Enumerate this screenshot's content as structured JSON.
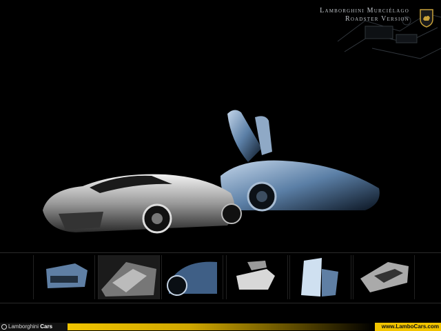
{
  "header": {
    "title_line1": "Lamborghini Murciélago",
    "title_line2": "Roadster Version"
  },
  "icons": {
    "crest": "lamborghini-bull-crest-icon"
  },
  "thumbnails": [
    {
      "name": "thumb-rear-view"
    },
    {
      "name": "thumb-interior"
    },
    {
      "name": "thumb-wheel-detail"
    },
    {
      "name": "thumb-rear-open"
    },
    {
      "name": "thumb-door-up"
    },
    {
      "name": "thumb-side-profile"
    }
  ],
  "footer": {
    "left_brand": "Lamborghini",
    "left_suffix": "Cars",
    "right_url": "www.LamboCars.com",
    "accent_color": "#f1c400"
  }
}
